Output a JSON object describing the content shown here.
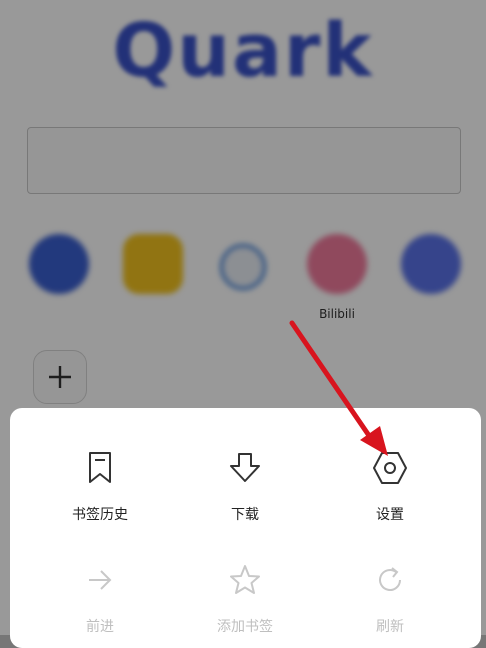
{
  "app": {
    "logo_text": "Quark"
  },
  "search": {
    "placeholder": ""
  },
  "shortcuts": [
    {
      "label": "",
      "color": "#3a5fd0",
      "icon": "shield-icon"
    },
    {
      "label": "",
      "color": "#f2c21e",
      "icon": "game-icon"
    },
    {
      "label": "",
      "color": "#e9eef6",
      "icon": "pinwheel-icon"
    },
    {
      "label": "Bilibili",
      "color": "#f07a9c",
      "icon": "tv-icon"
    },
    {
      "label": "",
      "color": "#5a72e8",
      "icon": "grid-icon"
    }
  ],
  "menu": {
    "bookmarks_history": "书签历史",
    "download": "下载",
    "settings": "设置",
    "forward": "前进",
    "add_bookmark": "添加书签",
    "refresh": "刷新"
  },
  "colors": {
    "accent": "#3a52c8",
    "annotation_arrow": "#d8141e",
    "disabled_text": "#bfbfbf"
  }
}
